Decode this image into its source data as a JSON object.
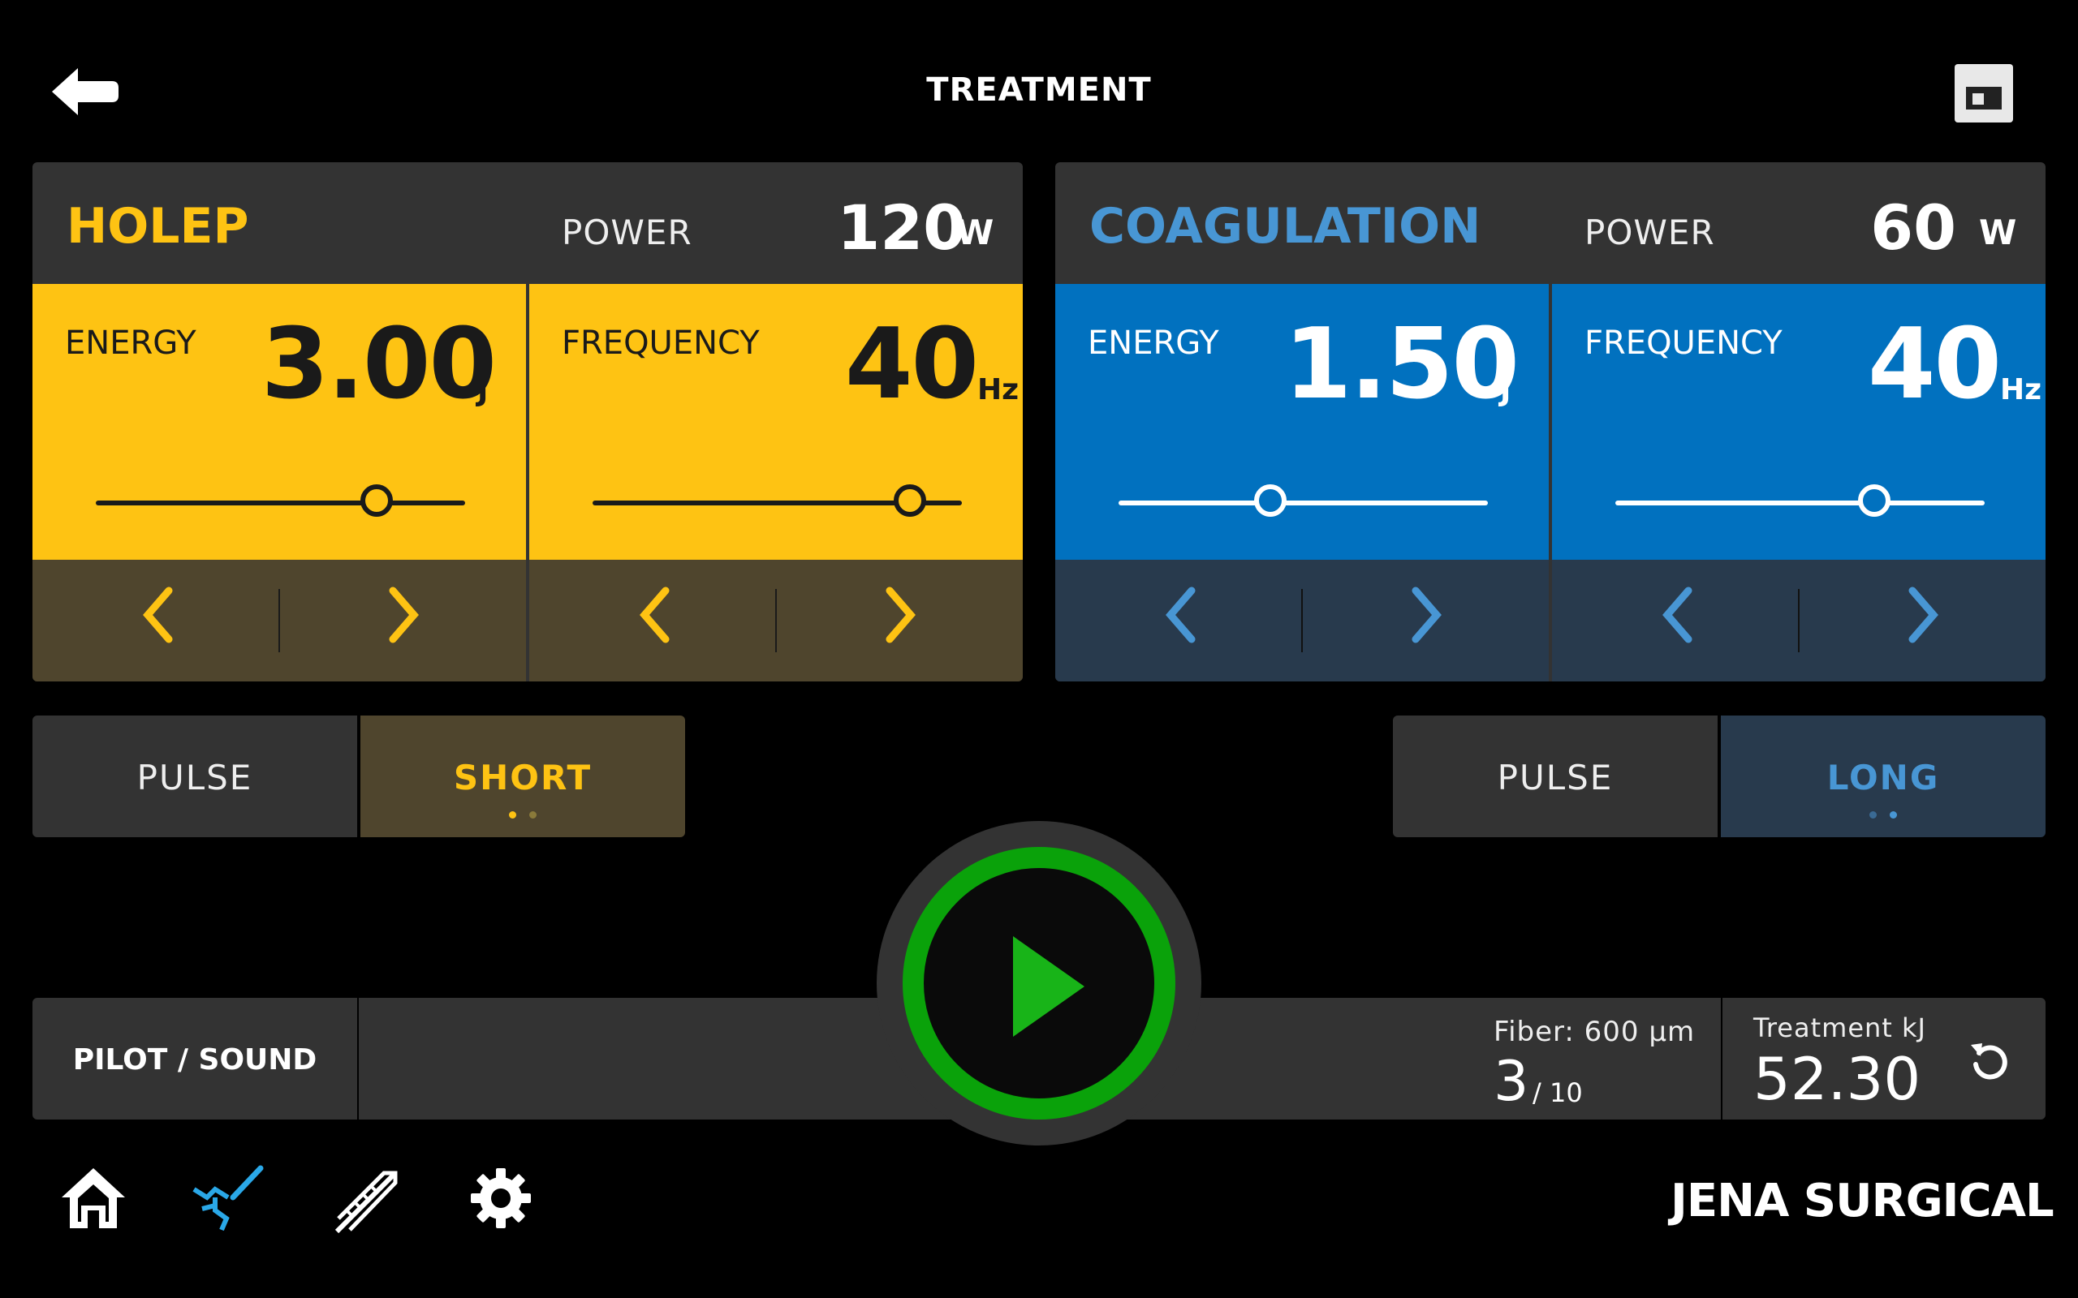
{
  "header": {
    "title": "TREATMENT",
    "back_icon": "back-arrow-icon",
    "save_icon": "save-icon"
  },
  "colors": {
    "holep_accent": "#fec313",
    "holep_dark": "#4f452d",
    "coag_accent": "#0171bf",
    "coag_text": "#4896d4",
    "coag_dark": "#283a4d",
    "play_green": "#0aa20a"
  },
  "holep": {
    "title": "HOLEP",
    "power_label": "POWER",
    "power_value": "120",
    "power_unit": "W",
    "energy": {
      "label": "ENERGY",
      "value": "3.00",
      "unit": "J",
      "slider_fraction": 0.76
    },
    "frequency": {
      "label": "FREQUENCY",
      "value": "40",
      "unit": "Hz",
      "slider_fraction": 0.86
    },
    "pulse": {
      "label": "PULSE",
      "mode": "SHORT",
      "mode_index": 0,
      "mode_count": 2
    }
  },
  "coagulation": {
    "title": "COAGULATION",
    "power_label": "POWER",
    "power_value": "60",
    "power_unit": "W",
    "energy": {
      "label": "ENERGY",
      "value": "1.50",
      "unit": "J",
      "slider_fraction": 0.41
    },
    "frequency": {
      "label": "FREQUENCY",
      "value": "40",
      "unit": "Hz",
      "slider_fraction": 0.7
    },
    "pulse": {
      "label": "PULSE",
      "mode": "LONG",
      "mode_index": 1,
      "mode_count": 2
    }
  },
  "bottom": {
    "pilot_label": "PILOT / SOUND",
    "fiber_label": "Fiber: 600 µm",
    "fiber_count": "3",
    "fiber_total": "/ 10",
    "treatment_label": "Treatment kJ",
    "treatment_value": "52.30"
  },
  "nav": {
    "items": [
      "home-icon",
      "laser-treatment-icon",
      "fiber-icon",
      "settings-icon"
    ],
    "active_index": 1
  },
  "brand": {
    "logo_text": "JENA SURGICAL"
  }
}
